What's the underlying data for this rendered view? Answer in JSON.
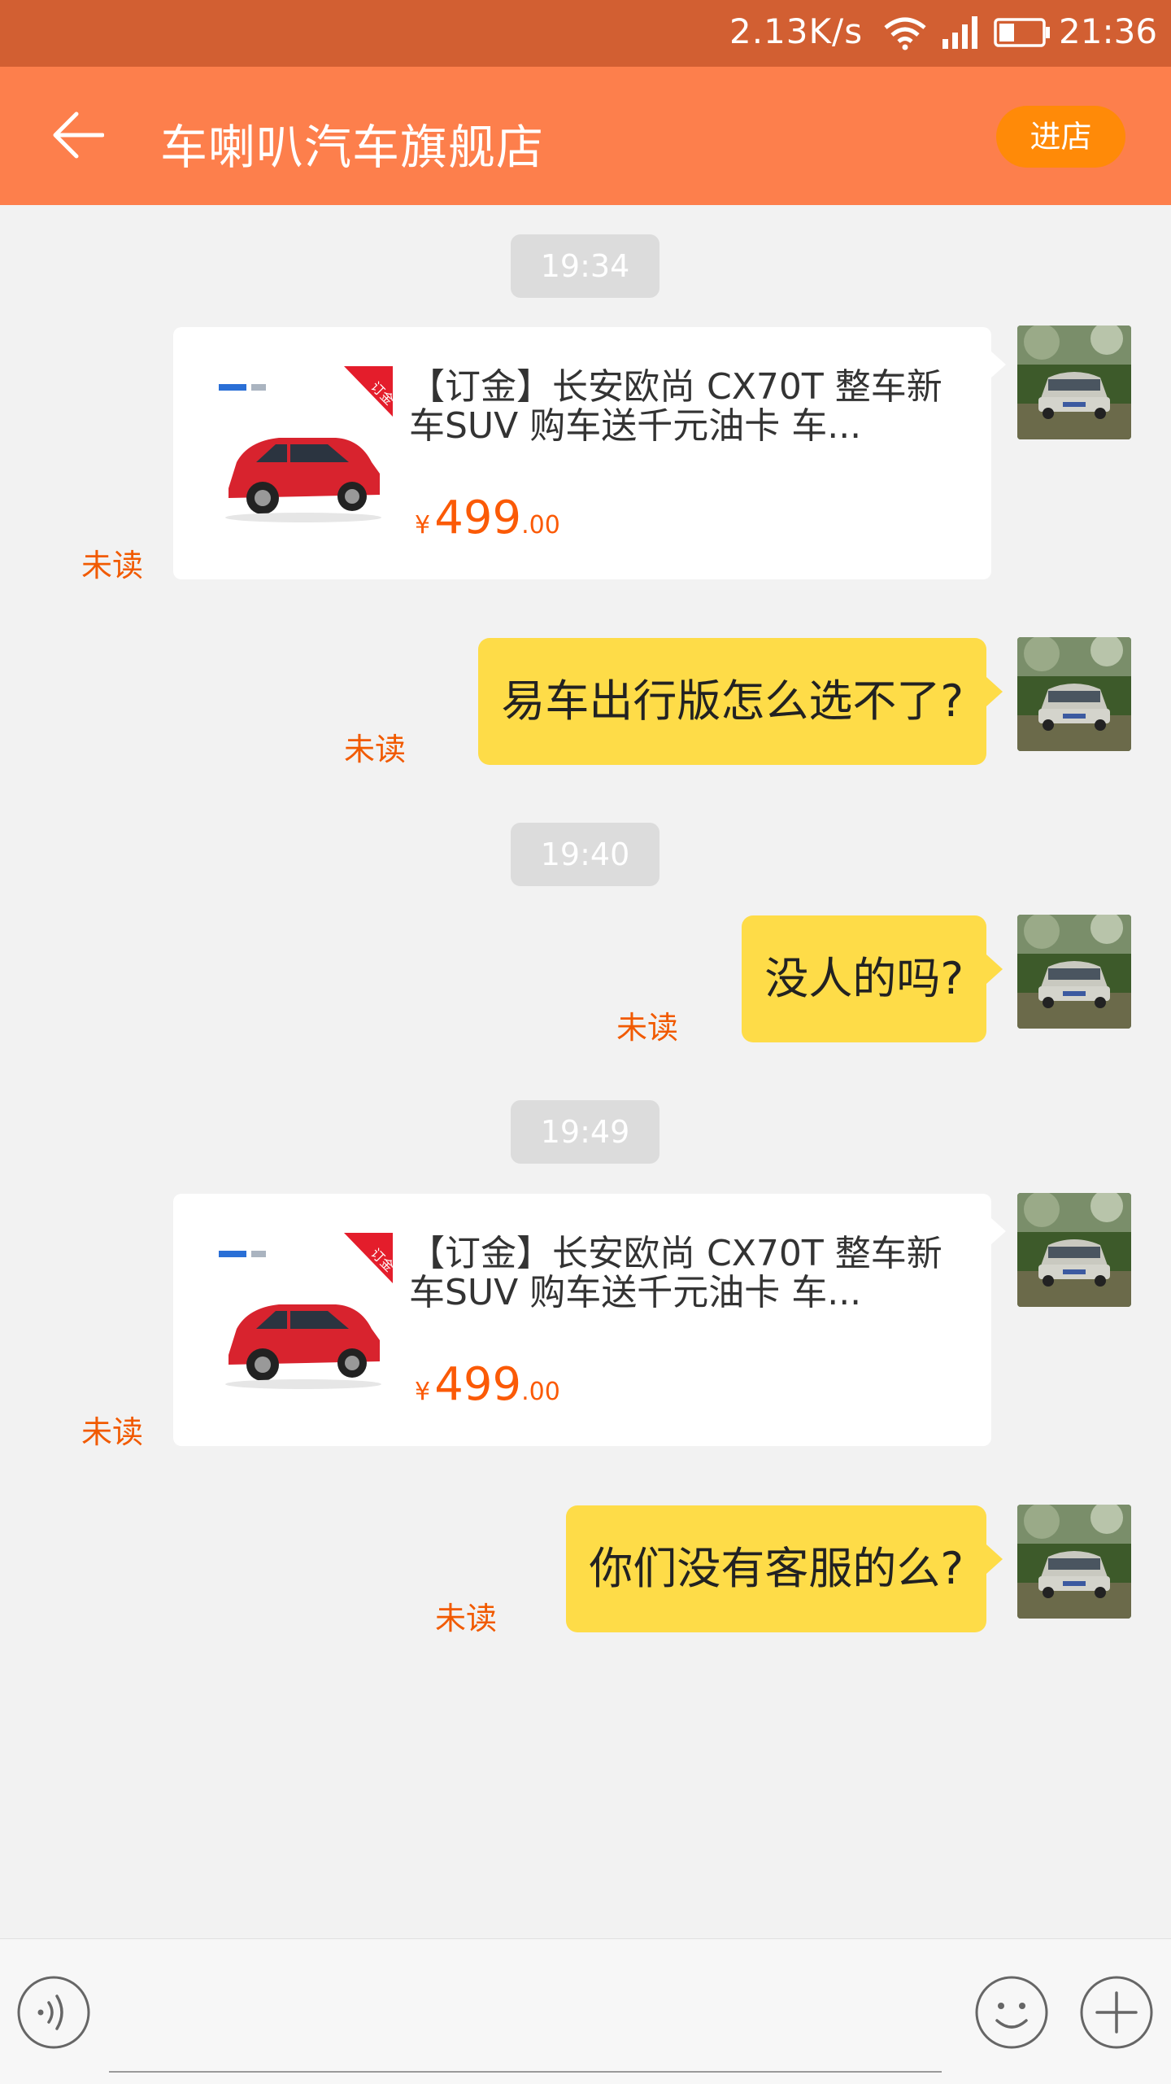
{
  "status_bar": {
    "speed": "2.13K/s",
    "time": "21:36",
    "icons": [
      "wifi-icon",
      "signal-icon",
      "battery-icon"
    ]
  },
  "header": {
    "title": "车喇叭汽车旗舰店",
    "shop_button": "进店",
    "back_icon": "back-arrow-icon"
  },
  "colors": {
    "status_bar": "#d25f32",
    "header": "#fd7f4c",
    "shop_button": "#ff8a08",
    "bubble": "#fedc48",
    "price": "#fb5a06",
    "unread": "#f15a00"
  },
  "messages": [
    {
      "type": "timestamp",
      "text": "19:34"
    },
    {
      "type": "product",
      "title": "【订金】长安欧尚 CX70T 整车新车SUV 购车送千元油卡 车...",
      "price_symbol": "¥",
      "price_int": "499",
      "price_dec": ".00",
      "tag": "订金",
      "status": "未读"
    },
    {
      "type": "text",
      "text": "易车出行版怎么选不了?",
      "status": "未读"
    },
    {
      "type": "timestamp",
      "text": "19:40"
    },
    {
      "type": "text",
      "text": "没人的吗?",
      "status": "未读"
    },
    {
      "type": "timestamp",
      "text": "19:49"
    },
    {
      "type": "product",
      "title": "【订金】长安欧尚 CX70T 整车新车SUV 购车送千元油卡 车...",
      "price_symbol": "¥",
      "price_int": "499",
      "price_dec": ".00",
      "tag": "订金",
      "status": "未读"
    },
    {
      "type": "text",
      "text": "你们没有客服的么?",
      "status": "未读"
    }
  ],
  "input_bar": {
    "voice_icon": "voice-icon",
    "emoji_icon": "emoji-icon",
    "plus_icon": "plus-icon",
    "input_value": ""
  }
}
